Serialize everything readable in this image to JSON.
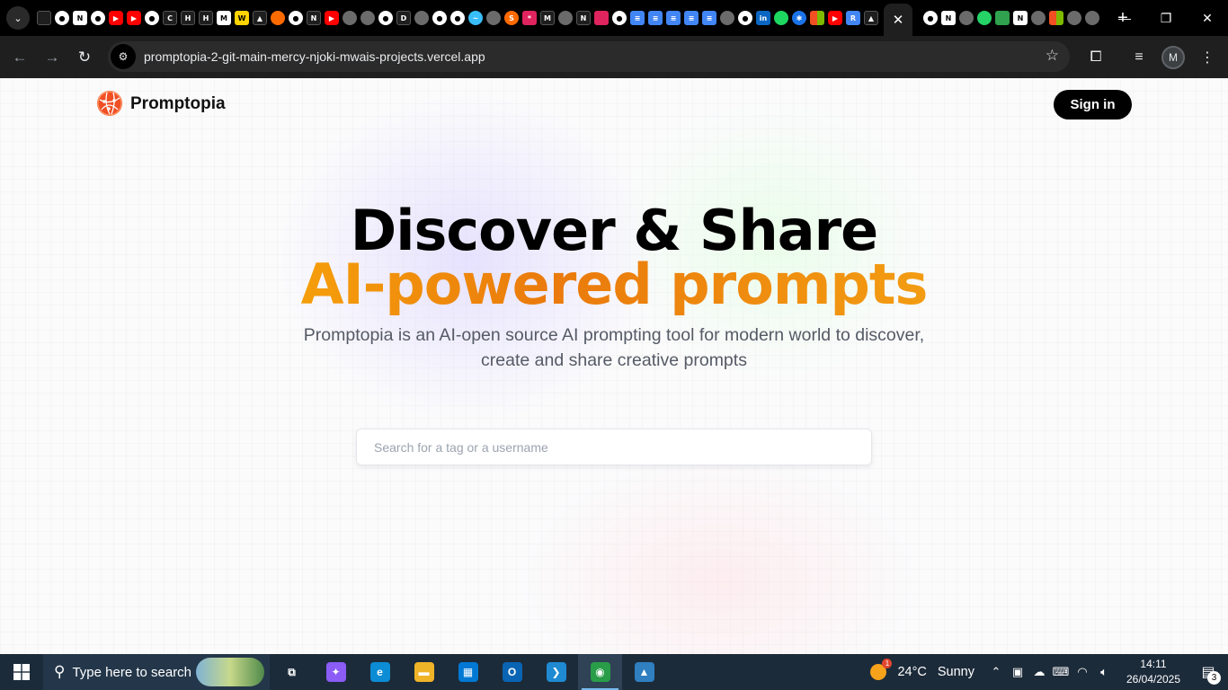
{
  "browser": {
    "url": "promptopia-2-git-main-mercy-njoki-mwais-projects.vercel.app",
    "profile_initial": "M",
    "pinned_tabs": [
      {
        "icon": "dark-square-icon",
        "cls": "fi-dk",
        "glyph": ""
      },
      {
        "icon": "github-icon",
        "cls": "fi-gh",
        "glyph": "●"
      },
      {
        "icon": "notion-icon",
        "cls": "fi-w",
        "glyph": "N"
      },
      {
        "icon": "github-icon",
        "cls": "fi-gh",
        "glyph": "●"
      },
      {
        "icon": "youtube-icon",
        "cls": "fi-yt",
        "glyph": "▶"
      },
      {
        "icon": "youtube-icon",
        "cls": "fi-yt",
        "glyph": "▶"
      },
      {
        "icon": "github-icon",
        "cls": "fi-gh",
        "glyph": "●"
      },
      {
        "icon": "codepen-icon",
        "cls": "fi-dk",
        "glyph": "C"
      },
      {
        "icon": "hashnode-icon",
        "cls": "fi-dk",
        "glyph": "H"
      },
      {
        "icon": "hashnode-icon",
        "cls": "fi-dk",
        "glyph": "H"
      },
      {
        "icon": "gmail-icon",
        "cls": "fi-w",
        "glyph": "M"
      },
      {
        "icon": "yellow-app-icon",
        "cls": "fi-y",
        "glyph": "W"
      },
      {
        "icon": "vercel-icon",
        "cls": "fi-dk",
        "glyph": "▲"
      },
      {
        "icon": "flame-icon",
        "cls": "fi-or",
        "glyph": ""
      },
      {
        "icon": "github-icon",
        "cls": "fi-gh",
        "glyph": "●"
      },
      {
        "icon": "nextjs-icon",
        "cls": "fi-dk",
        "glyph": "N"
      },
      {
        "icon": "youtube-icon",
        "cls": "fi-yt",
        "glyph": "▶"
      },
      {
        "icon": "globe-icon",
        "cls": "fi-gray",
        "glyph": ""
      },
      {
        "icon": "globe-icon",
        "cls": "fi-gray",
        "glyph": ""
      },
      {
        "icon": "github-icon",
        "cls": "fi-gh",
        "glyph": "●"
      },
      {
        "icon": "dev-icon",
        "cls": "fi-dk",
        "glyph": "D"
      },
      {
        "icon": "globe-icon",
        "cls": "fi-gray",
        "glyph": ""
      },
      {
        "icon": "github-icon",
        "cls": "fi-gh",
        "glyph": "●"
      },
      {
        "icon": "github-icon",
        "cls": "fi-gh",
        "glyph": "●"
      },
      {
        "icon": "tailwind-icon",
        "cls": "fi-tw",
        "glyph": "~"
      },
      {
        "icon": "globe-icon",
        "cls": "fi-gray",
        "glyph": ""
      },
      {
        "icon": "stackoverflow-icon",
        "cls": "fi-or",
        "glyph": "S"
      },
      {
        "icon": "asterisk-icon",
        "cls": "fi-pk",
        "glyph": "*"
      },
      {
        "icon": "medium-icon",
        "cls": "fi-dk",
        "glyph": "M"
      },
      {
        "icon": "globe-icon",
        "cls": "fi-gray",
        "glyph": ""
      },
      {
        "icon": "notion-icon",
        "cls": "fi-dk",
        "glyph": "N"
      },
      {
        "icon": "flag-icon",
        "cls": "fi-pk",
        "glyph": ""
      },
      {
        "icon": "github-icon",
        "cls": "fi-gh",
        "glyph": "●"
      },
      {
        "icon": "docs-icon",
        "cls": "fi-doc",
        "glyph": "≡"
      },
      {
        "icon": "docs-icon",
        "cls": "fi-doc",
        "glyph": "≡"
      },
      {
        "icon": "docs-icon",
        "cls": "fi-doc",
        "glyph": "≡"
      },
      {
        "icon": "docs-icon",
        "cls": "fi-doc",
        "glyph": "≡"
      },
      {
        "icon": "docs-icon",
        "cls": "fi-doc",
        "glyph": "≡"
      },
      {
        "icon": "globe-icon",
        "cls": "fi-gray",
        "glyph": ""
      },
      {
        "icon": "github-icon",
        "cls": "fi-gh",
        "glyph": "●"
      },
      {
        "icon": "linkedin-icon",
        "cls": "fi-li",
        "glyph": "in"
      },
      {
        "icon": "spotify-icon",
        "cls": "fi-sp",
        "glyph": ""
      },
      {
        "icon": "gear-icon",
        "cls": "fi-bl",
        "glyph": "✱"
      },
      {
        "icon": "microsoft-icon",
        "cls": "fi-ms",
        "glyph": ""
      },
      {
        "icon": "youtube-icon",
        "cls": "fi-yt",
        "glyph": "▶"
      },
      {
        "icon": "repo-icon",
        "cls": "fi-doc",
        "glyph": "R"
      },
      {
        "icon": "vercel-icon",
        "cls": "fi-dk",
        "glyph": "▲"
      }
    ],
    "pinned_tabs_after": [
      {
        "icon": "github-icon",
        "cls": "fi-gh",
        "glyph": "●"
      },
      {
        "icon": "notion-icon",
        "cls": "fi-w",
        "glyph": "N"
      },
      {
        "icon": "openai-icon",
        "cls": "fi-gray",
        "glyph": ""
      },
      {
        "icon": "whatsapp-icon",
        "cls": "fi-wa",
        "glyph": ""
      },
      {
        "icon": "green-app-icon",
        "cls": "fi-gr",
        "glyph": ""
      },
      {
        "icon": "notion-icon",
        "cls": "fi-w",
        "glyph": "N"
      },
      {
        "icon": "globe-icon",
        "cls": "fi-gray",
        "glyph": ""
      },
      {
        "icon": "colorful-app-icon",
        "cls": "fi-ms",
        "glyph": ""
      },
      {
        "icon": "globe-icon",
        "cls": "fi-gray",
        "glyph": ""
      },
      {
        "icon": "globe-icon",
        "cls": "fi-gray",
        "glyph": ""
      }
    ]
  },
  "page": {
    "brand": "Promptopia",
    "signin_label": "Sign in",
    "hero_line1": "Discover & Share",
    "hero_line2": "AI-powered prompts",
    "description": "Promptopia is an AI-open source AI prompting tool for modern world to discover, create and share creative prompts",
    "search_placeholder": "Search for a tag or a username",
    "search_value": ""
  },
  "taskbar": {
    "search_placeholder": "Type here to search",
    "apps": [
      {
        "icon": "task-view-icon",
        "glyph": "⧉",
        "color": "#1c2b3a"
      },
      {
        "icon": "copilot-icon",
        "glyph": "✦",
        "color": "#8b5cf6"
      },
      {
        "icon": "edge-icon",
        "glyph": "e",
        "color": "#0c8cd4"
      },
      {
        "icon": "file-explorer-icon",
        "glyph": "▬",
        "color": "#f0b429"
      },
      {
        "icon": "microsoft-store-icon",
        "glyph": "▦",
        "color": "#0078d4"
      },
      {
        "icon": "outlook-icon",
        "glyph": "O",
        "color": "#0a64b4"
      },
      {
        "icon": "vscode-icon",
        "glyph": "❯",
        "color": "#1f8ad2"
      },
      {
        "icon": "chrome-icon",
        "glyph": "◉",
        "color": "#2a9d48",
        "active": true
      },
      {
        "icon": "photos-icon",
        "glyph": "▲",
        "color": "#2f7fc1"
      }
    ],
    "weather_temp": "24°C",
    "weather_cond": "Sunny",
    "weather_badge": "1",
    "time": "14:11",
    "date": "26/04/2025",
    "notifications": "3"
  }
}
